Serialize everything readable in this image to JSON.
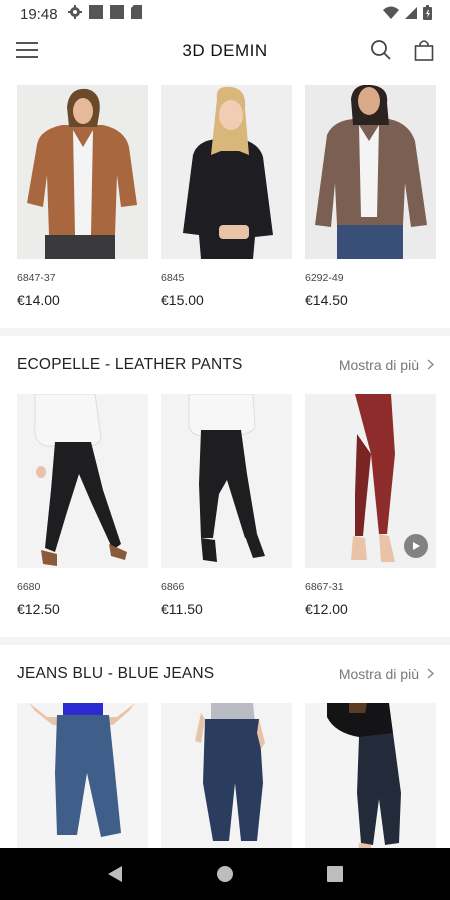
{
  "status_bar": {
    "time": "19:48"
  },
  "header": {
    "title": "3D DEMIN"
  },
  "top_row": {
    "products": [
      {
        "code": "6847-37",
        "price": "€14.00"
      },
      {
        "code": "6845",
        "price": "€15.00"
      },
      {
        "code": "6292-49",
        "price": "€14.50"
      }
    ]
  },
  "sections": [
    {
      "title": "ECOPELLE - LEATHER PANTS",
      "more_label": "Mostra di più",
      "products": [
        {
          "code": "6680",
          "price": "€12.50"
        },
        {
          "code": "6866",
          "price": "€11.50"
        },
        {
          "code": "6867-31",
          "price": "€12.00"
        }
      ]
    },
    {
      "title": "JEANS BLU - BLUE JEANS",
      "more_label": "Mostra di più",
      "products": [
        {
          "code": "",
          "price": ""
        },
        {
          "code": "",
          "price": ""
        },
        {
          "code": "",
          "price": ""
        }
      ]
    }
  ],
  "colors": {
    "background": "#f3f3f3",
    "surface": "#ffffff",
    "nav_bar": "#000000",
    "brown_jacket": "#a8673f",
    "black_jacket": "#1d1d22",
    "taupe_jacket": "#7a5f52",
    "black_pants": "#1e1e20",
    "red_pants": "#8e2c2c",
    "blue_jeans": "#3f5f8a",
    "dark_jeans": "#2a3d5e"
  },
  "icons": {
    "status_left": [
      "gear-icon",
      "app-icon",
      "app-icon",
      "sim-icon"
    ],
    "status_right": [
      "wifi-icon",
      "signal-icon",
      "battery-icon"
    ],
    "header_left": "hamburger-menu-icon",
    "header_right": [
      "search-icon",
      "shopping-bag-icon"
    ],
    "nav": [
      "back-icon",
      "home-icon",
      "recents-icon"
    ]
  }
}
